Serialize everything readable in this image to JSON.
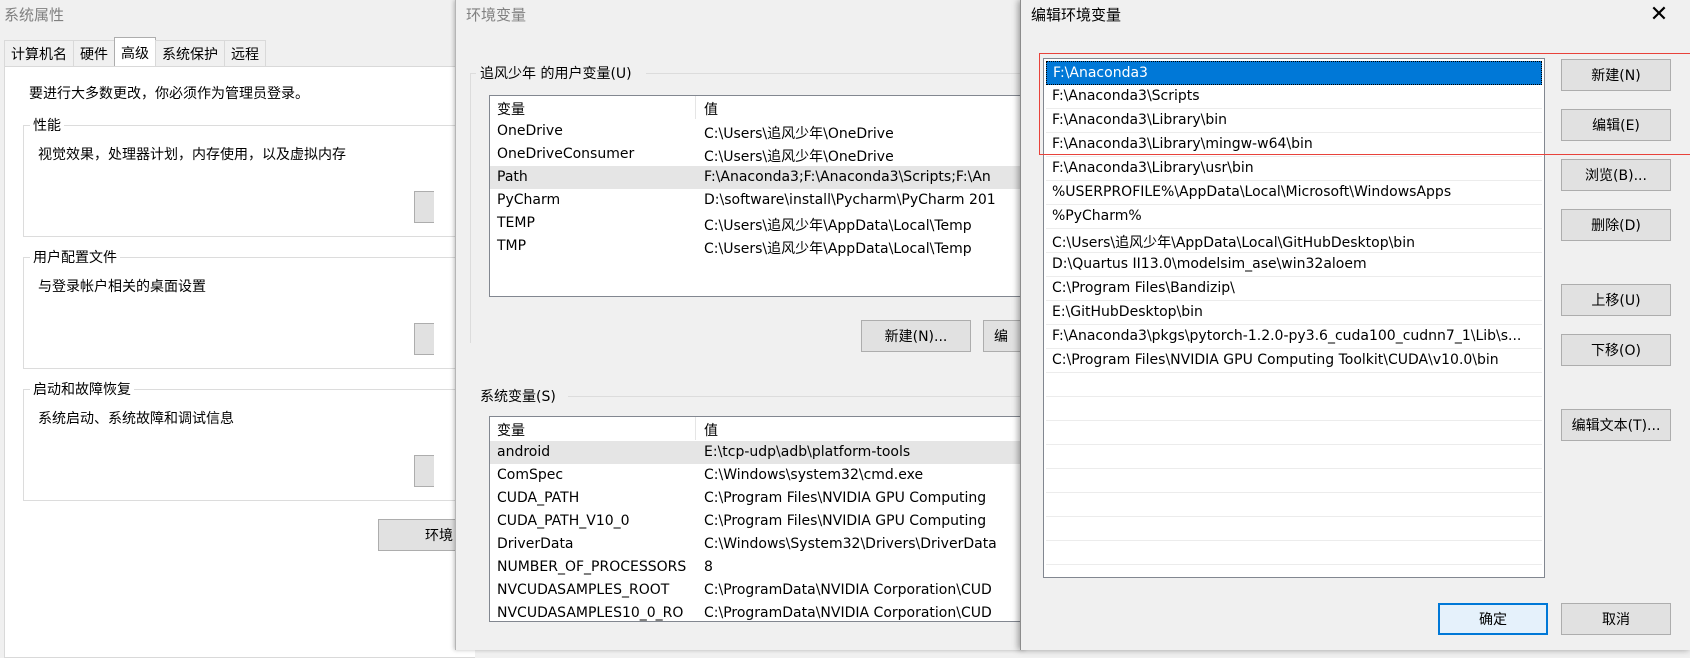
{
  "system_properties": {
    "title": "系统属性",
    "tabs": [
      "计算机名",
      "硬件",
      "高级",
      "系统保护",
      "远程"
    ],
    "admin_notice": "要进行大多数更改，你必须作为管理员登录。",
    "performance": {
      "legend": "性能",
      "desc": "视觉效果，处理器计划，内存使用，以及虚拟内存"
    },
    "user_profiles": {
      "legend": "用户配置文件",
      "desc": "与登录帐户相关的桌面设置"
    },
    "startup_recovery": {
      "legend": "启动和故障恢复",
      "desc": "系统启动、系统故障和调试信息"
    },
    "env_button_label": "环境"
  },
  "env_vars": {
    "title": "环境变量",
    "user_legend": "追风少年 的用户变量(U)",
    "columns": [
      "变量",
      "值"
    ],
    "user_vars": [
      {
        "name": "OneDrive",
        "value": "C:\\Users\\追风少年\\OneDrive"
      },
      {
        "name": "OneDriveConsumer",
        "value": "C:\\Users\\追风少年\\OneDrive"
      },
      {
        "name": "Path",
        "value": "F:\\Anaconda3;F:\\Anaconda3\\Scripts;F:\\An"
      },
      {
        "name": "PyCharm",
        "value": "D:\\software\\install\\Pycharm\\PyCharm 201"
      },
      {
        "name": "TEMP",
        "value": "C:\\Users\\追风少年\\AppData\\Local\\Temp"
      },
      {
        "name": "TMP",
        "value": "C:\\Users\\追风少年\\AppData\\Local\\Temp"
      }
    ],
    "user_new_button": "新建(N)...",
    "user_edit_button": "编",
    "system_legend": "系统变量(S)",
    "system_vars": [
      {
        "name": "android",
        "value": "E:\\tcp-udp\\adb\\platform-tools"
      },
      {
        "name": "ComSpec",
        "value": "C:\\Windows\\system32\\cmd.exe"
      },
      {
        "name": "CUDA_PATH",
        "value": "C:\\Program Files\\NVIDIA GPU Computing"
      },
      {
        "name": "CUDA_PATH_V10_0",
        "value": "C:\\Program Files\\NVIDIA GPU Computing"
      },
      {
        "name": "DriverData",
        "value": "C:\\Windows\\System32\\Drivers\\DriverData"
      },
      {
        "name": "NUMBER_OF_PROCESSORS",
        "value": "8"
      },
      {
        "name": "NVCUDASAMPLES_ROOT",
        "value": "C:\\ProgramData\\NVIDIA Corporation\\CUD"
      },
      {
        "name": "NVCUDASAMPLES10_0_RO",
        "value": "C:\\ProgramData\\NVIDIA Corporation\\CUD"
      }
    ]
  },
  "edit_env": {
    "title": "编辑环境变量",
    "close_glyph": "✕",
    "paths": [
      "F:\\Anaconda3",
      "F:\\Anaconda3\\Scripts",
      "F:\\Anaconda3\\Library\\bin",
      "F:\\Anaconda3\\Library\\mingw-w64\\bin",
      "F:\\Anaconda3\\Library\\usr\\bin",
      "%USERPROFILE%\\AppData\\Local\\Microsoft\\WindowsApps",
      "%PyCharm%",
      "C:\\Users\\追风少年\\AppData\\Local\\GitHubDesktop\\bin",
      "D:\\Quartus II13.0\\modelsim_ase\\win32aloem",
      "C:\\Program Files\\Bandizip\\",
      "E:\\GitHubDesktop\\bin",
      "F:\\Anaconda3\\pkgs\\pytorch-1.2.0-py3.6_cuda100_cudnn7_1\\Lib\\s...",
      "C:\\Program Files\\NVIDIA GPU Computing Toolkit\\CUDA\\v10.0\\bin",
      "",
      "",
      "",
      "",
      "",
      "",
      "",
      ""
    ],
    "buttons": {
      "new": "新建(N)",
      "edit": "编辑(E)",
      "browse": "浏览(B)...",
      "delete": "删除(D)",
      "move_up": "上移(U)",
      "move_down": "下移(O)",
      "edit_text": "编辑文本(T)...",
      "ok": "确定",
      "cancel": "取消"
    },
    "highlight_color": "#e8423b",
    "selection_color": "#0078d7"
  }
}
